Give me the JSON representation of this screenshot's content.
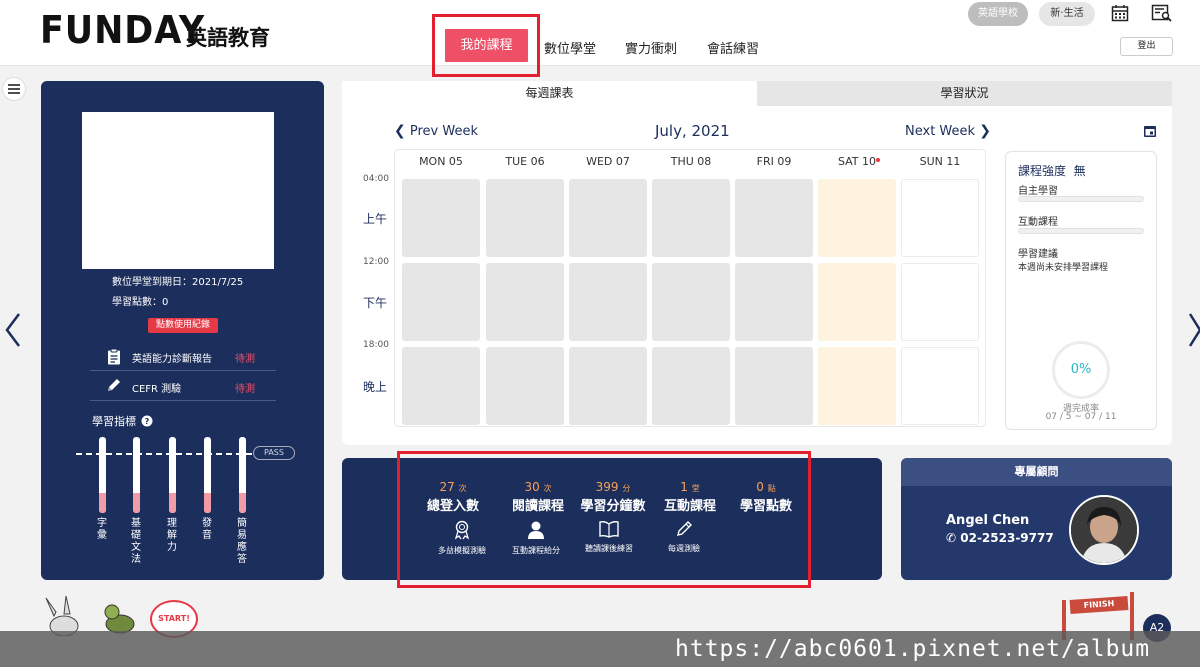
{
  "header": {
    "logo": "FUNDAY",
    "logo_sub": "英語教育",
    "nav": [
      "我的課程",
      "數位學堂",
      "實力衝刺",
      "會話練習"
    ],
    "school_pill": "英語學校",
    "life_pill": "新·生活",
    "logout": "登出"
  },
  "profile": {
    "expiry": "數位學堂到期日：2021/7/25",
    "points": "學習點數：0",
    "points_btn": "點數使用紀錄",
    "report_label": "英語能力診斷報告",
    "report_status": "待測",
    "cefr_label": "CEFR 測驗",
    "cefr_status": "待測",
    "indicator_title": "學習指標",
    "pass_label": "PASS",
    "bars": [
      {
        "label": "字彙",
        "level": 0.26
      },
      {
        "label": "基礎文法",
        "level": 0.26
      },
      {
        "label": "理解力",
        "level": 0.26
      },
      {
        "label": "發音",
        "level": 0.26
      },
      {
        "label": "簡易應答",
        "level": 0.26
      }
    ]
  },
  "tabs": {
    "weekly": "每週課表",
    "status": "學習狀況"
  },
  "calendar": {
    "prev": "Prev Week",
    "next": "Next Week",
    "month": "July, 2021",
    "days": [
      "MON 05",
      "TUE 06",
      "WED 07",
      "THU 08",
      "FRI 09",
      "SAT 10",
      "SUN 11"
    ],
    "times": [
      "04:00",
      "12:00",
      "18:00"
    ],
    "periods": [
      "上午",
      "下午",
      "晚上"
    ]
  },
  "intensity": {
    "title": "課程強度",
    "value": "無",
    "self_study": "自主學習",
    "interactive": "互動課程",
    "advice_title": "學習建議",
    "advice_text": "本週尚未安排學習課程",
    "completion": "0%",
    "completion_label": "週完成率",
    "range": "07 / 5 ~ 07 / 11",
    "accent": "#29b6c9"
  },
  "stats": [
    {
      "value": "27",
      "unit": "次",
      "label": "總登入數"
    },
    {
      "value": "30",
      "unit": "次",
      "label": "閱讀課程"
    },
    {
      "value": "399",
      "unit": "分",
      "label": "學習分鐘數"
    },
    {
      "value": "1",
      "unit": "堂",
      "label": "互動課程"
    },
    {
      "value": "0",
      "unit": "點",
      "label": "學習點數"
    }
  ],
  "tools": [
    {
      "icon": "award-icon",
      "label": "多益模擬測驗"
    },
    {
      "icon": "user-icon",
      "label": "互動課程給分"
    },
    {
      "icon": "book-icon",
      "label": "聽讀課後練習"
    },
    {
      "icon": "pen-icon",
      "label": "每週測驗"
    }
  ],
  "advisor": {
    "title": "專屬顧問",
    "name": "Angel Chen",
    "phone": "02-2523-9777"
  },
  "decor": {
    "start": "START!",
    "finish": "FINISH",
    "badge": "A2"
  },
  "watermark": "https://abc0601.pixnet.net/album"
}
